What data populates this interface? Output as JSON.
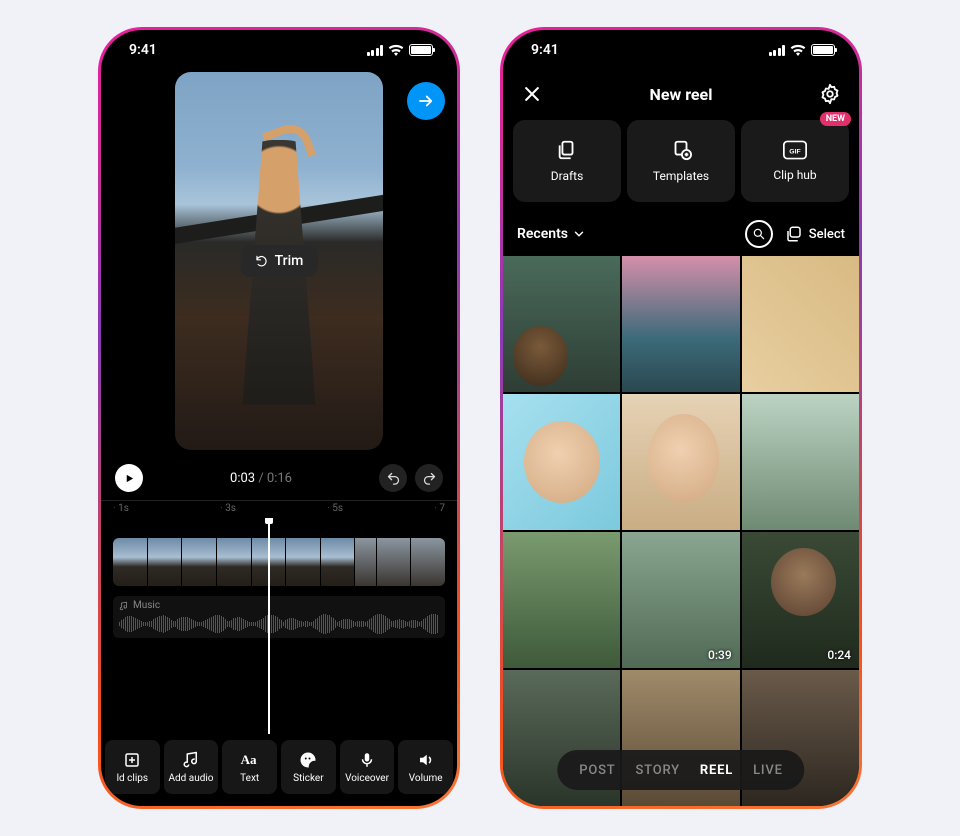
{
  "status": {
    "time": "9:41"
  },
  "editor": {
    "trim_label": "Trim",
    "time_current": "0:03",
    "time_total": "/ 0:16",
    "ruler": [
      "1s",
      "3s",
      "5s",
      "7"
    ],
    "music_label": "Music",
    "tools": [
      {
        "key": "add-clips",
        "label": "ld clips"
      },
      {
        "key": "add-audio",
        "label": "Add audio"
      },
      {
        "key": "text",
        "label": "Text"
      },
      {
        "key": "sticker",
        "label": "Sticker"
      },
      {
        "key": "voiceover",
        "label": "Voiceover"
      },
      {
        "key": "volume",
        "label": "Volume"
      }
    ]
  },
  "newreel": {
    "title": "New reel",
    "sources": {
      "drafts": "Drafts",
      "templates": "Templates",
      "cliphub": "Clip hub",
      "cliphub_badge": "NEW"
    },
    "album_label": "Recents",
    "select_label": "Select",
    "durations": {
      "g8": "0:39",
      "g9": "0:24"
    },
    "modes": [
      "POST",
      "STORY",
      "REEL",
      "LIVE"
    ],
    "active_mode": "REEL"
  }
}
